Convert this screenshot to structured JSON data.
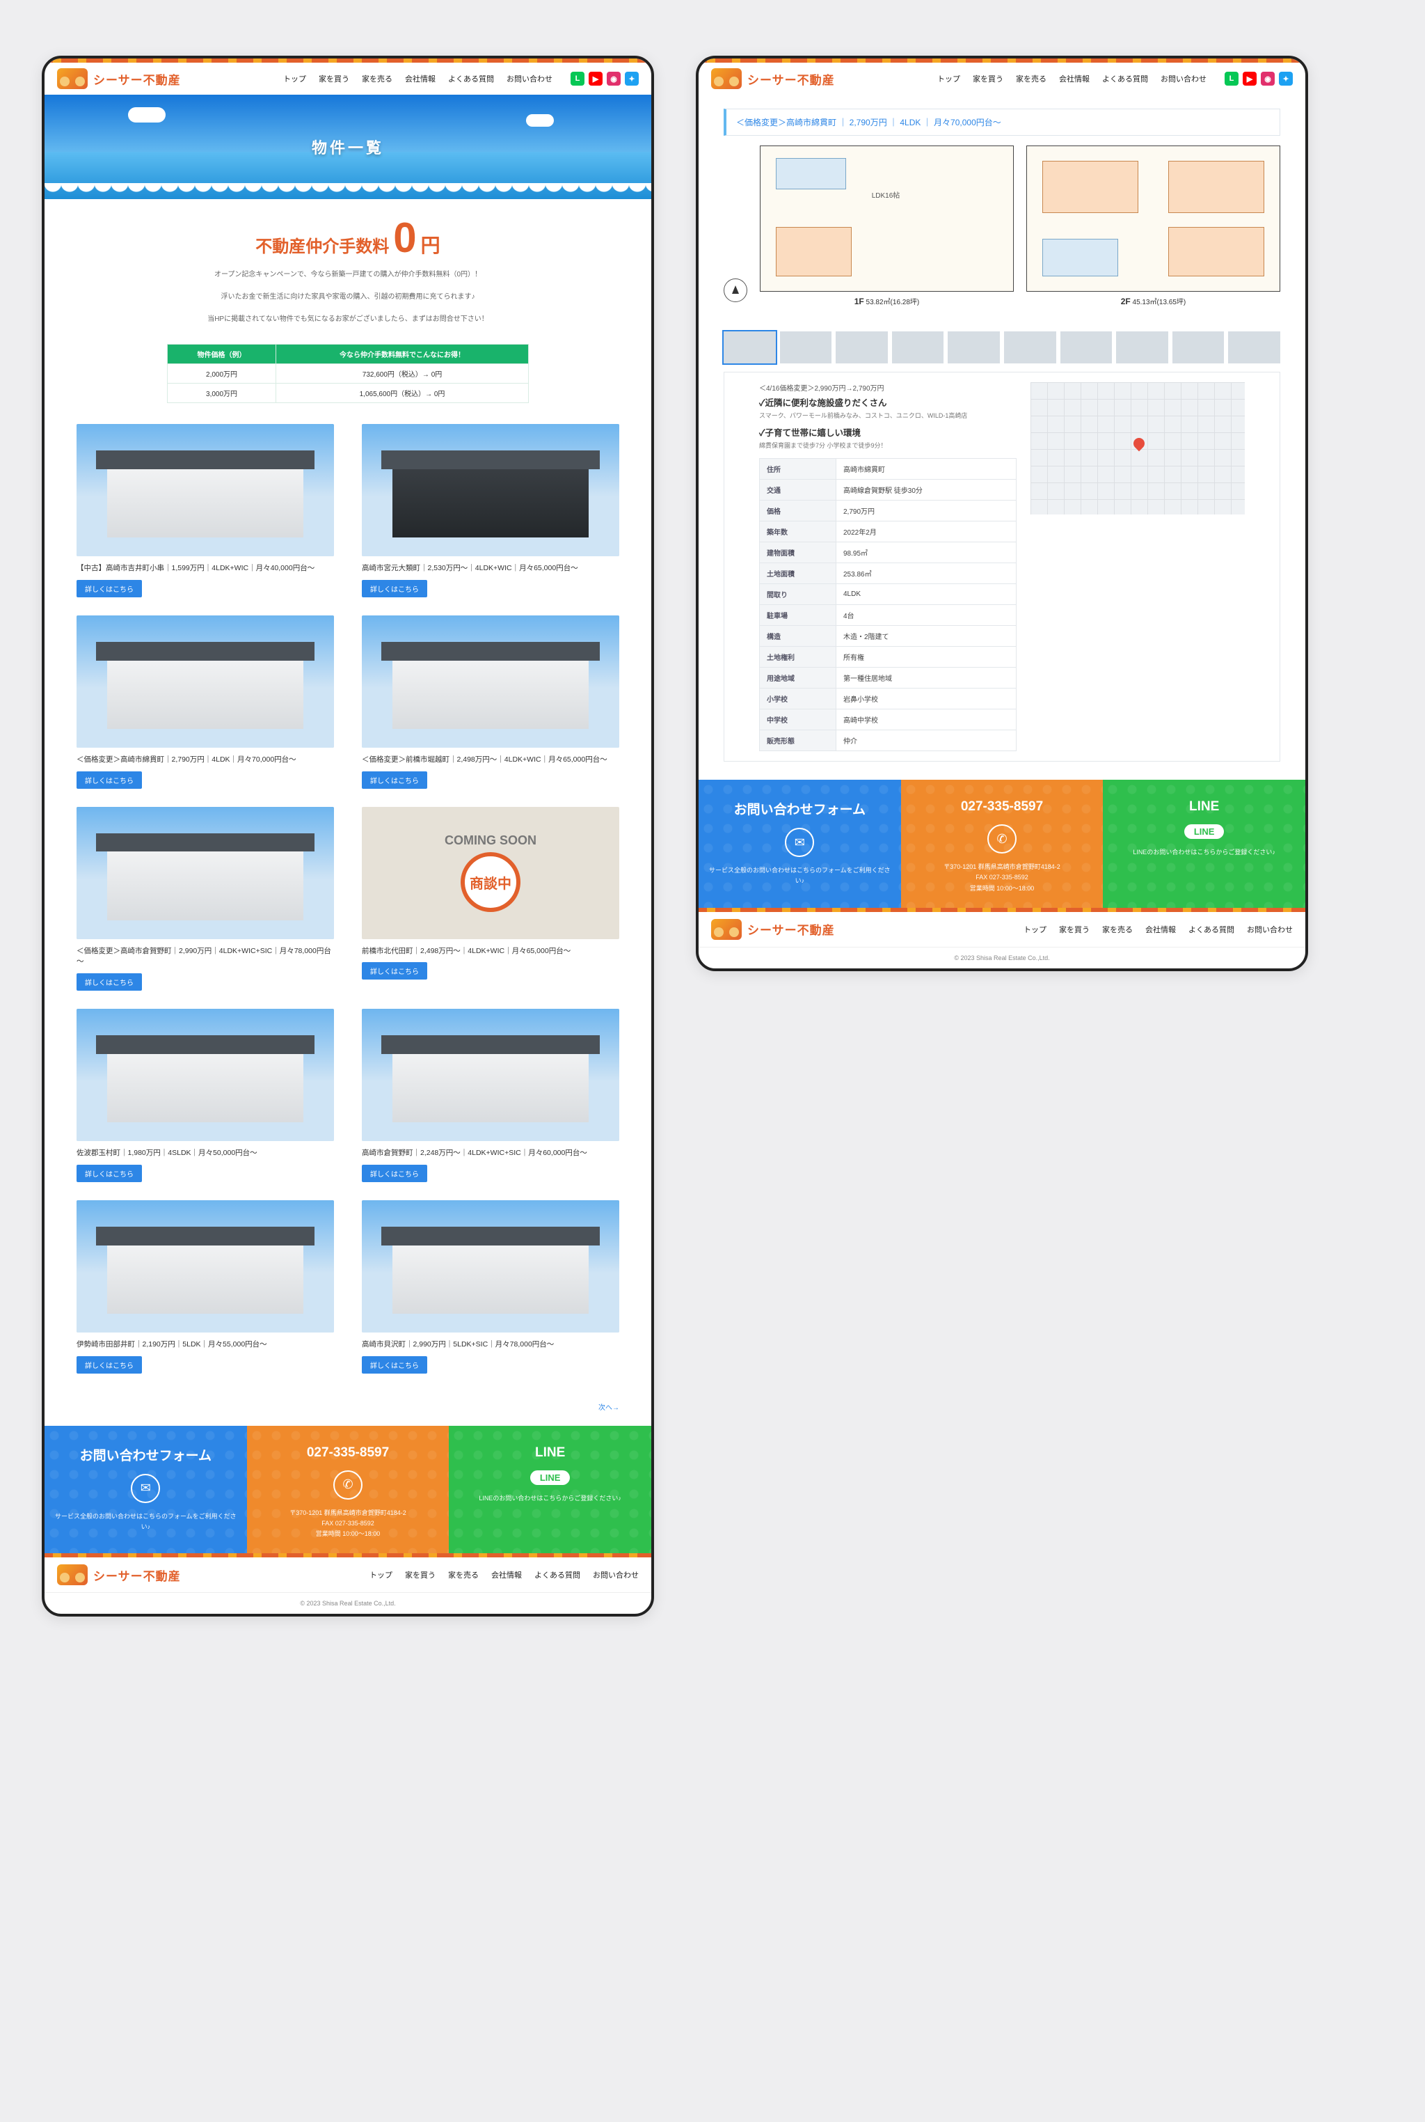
{
  "brand": "シーサー不動産",
  "nav": {
    "top": "トップ",
    "buy": "家を買う",
    "sell": "家を売る",
    "company": "会社情報",
    "faq": "よくある質問",
    "contact": "お問い合わせ"
  },
  "hero_title": "物件一覧",
  "promo": {
    "pre": "不動産仲介手数料",
    "big": "0",
    "yen": "円",
    "body1": "オープン記念キャンペーンで、今なら新築一戸建ての購入が仲介手数料無料（0円）！",
    "body2": "浮いたお金で新生活に向けた家具や家電の購入、引越の初期費用に充てられます♪",
    "body3": "当HPに掲載されてない物件でも気になるお家がございましたら、まずはお問合せ下さい！"
  },
  "th1": "物件価格（例）",
  "th2": "今なら仲介手数料無料でこんなにお得！",
  "r1a": "2,000万円",
  "r1b": "732,600円（税込）→ 0円",
  "r2a": "3,000万円",
  "r2b": "1,065,600円（税込）→ 0円",
  "cards": [
    {
      "t": "【中古】高崎市吉井町小串｜1,599万円｜4LDK+WIC｜月々40,000円台～",
      "k": "light"
    },
    {
      "t": "高崎市宮元大類町｜2,530万円～｜4LDK+WIC｜月々65,000円台～",
      "k": "dark"
    },
    {
      "t": "＜価格変更＞高崎市綿貫町｜2,790万円｜4LDK｜月々70,000円台～",
      "k": "light"
    },
    {
      "t": "＜価格変更＞前橋市堀越町｜2,498万円～｜4LDK+WIC｜月々65,000円台～",
      "k": "light"
    },
    {
      "t": "＜価格変更＞高崎市倉賀野町｜2,990万円｜4LDK+WIC+SIC｜月々78,000円台～",
      "k": "light"
    },
    {
      "t": "前橋市北代田町｜2,498万円～｜4LDK+WIC｜月々65,000円台～",
      "k": "soon",
      "soon": "COMING SOON",
      "badge": "商談中"
    },
    {
      "t": "佐波郡玉村町｜1,980万円｜4SLDK｜月々50,000円台～",
      "k": "light"
    },
    {
      "t": "高崎市倉賀野町｜2,248万円～｜4LDK+WIC+SIC｜月々60,000円台～",
      "k": "light"
    },
    {
      "t": "伊勢崎市田部井町｜2,190万円｜5LDK｜月々55,000円台～",
      "k": "light"
    },
    {
      "t": "高崎市貝沢町｜2,990万円｜5LDK+SIC｜月々78,000円台～",
      "k": "light"
    }
  ],
  "btn_label": "詳しくはこちら",
  "next_label": "次へ→",
  "cta": {
    "a_ttl": "お問い合わせフォーム",
    "a_msg": "サービス全般のお問い合わせはこちらのフォームをご利用ください♪",
    "b_ttl": "027-335-8597",
    "b_msg1": "〒370-1201 群馬県高崎市倉賀野町4184-2",
    "b_msg2": "FAX 027-335-8592",
    "b_msg3": "営業時間 10:00～18:00",
    "c_ttl": "LINE",
    "c_pill": "LINE",
    "c_msg": "LINEのお問い合わせはこちらからご登録ください♪"
  },
  "copyright": "© 2023 Shisa Real Estate Co.,Ltd.",
  "detail_crumb": "＜価格変更＞高崎市綿貫町 ｜ 2,790万円 ｜ 4LDK ｜ 月々70,000円台～",
  "plan1_ldk": "LDK16帖",
  "plan1_cap_num": "1F",
  "plan1_cap": " 53.82㎡(16.28坪)",
  "plan2_cap_num": "2F",
  "plan2_cap": " 45.13㎡(13.65坪)",
  "feat_lead": "＜4/16価格変更＞2,990万円→2,790万円",
  "feat_h1": "✓近隣に便利な施設盛りだくさん",
  "feat_s1": "スマーク、パワーモール前橋みなみ、コストコ、ユニクロ、WILD-1高崎店",
  "feat_h2": "✓子育て世帯に嬉しい環境",
  "feat_s2": "綿貫保育園まで徒歩7分 小学校まで徒歩9分！",
  "spec": [
    [
      "住所",
      "高崎市綿貫町"
    ],
    [
      "交通",
      "高崎線倉賀野駅 徒歩30分"
    ],
    [
      "価格",
      "2,790万円"
    ],
    [
      "築年数",
      "2022年2月"
    ],
    [
      "建物面積",
      "98.95㎡"
    ],
    [
      "土地面積",
      "253.86㎡"
    ],
    [
      "間取り",
      "4LDK"
    ],
    [
      "駐車場",
      "4台"
    ],
    [
      "構造",
      "木造・2階建て"
    ],
    [
      "土地権利",
      "所有権"
    ],
    [
      "用途地域",
      "第一種住居地域"
    ],
    [
      "小学校",
      "岩鼻小学校"
    ],
    [
      "中学校",
      "高崎中学校"
    ],
    [
      "販売形態",
      "仲介"
    ]
  ]
}
